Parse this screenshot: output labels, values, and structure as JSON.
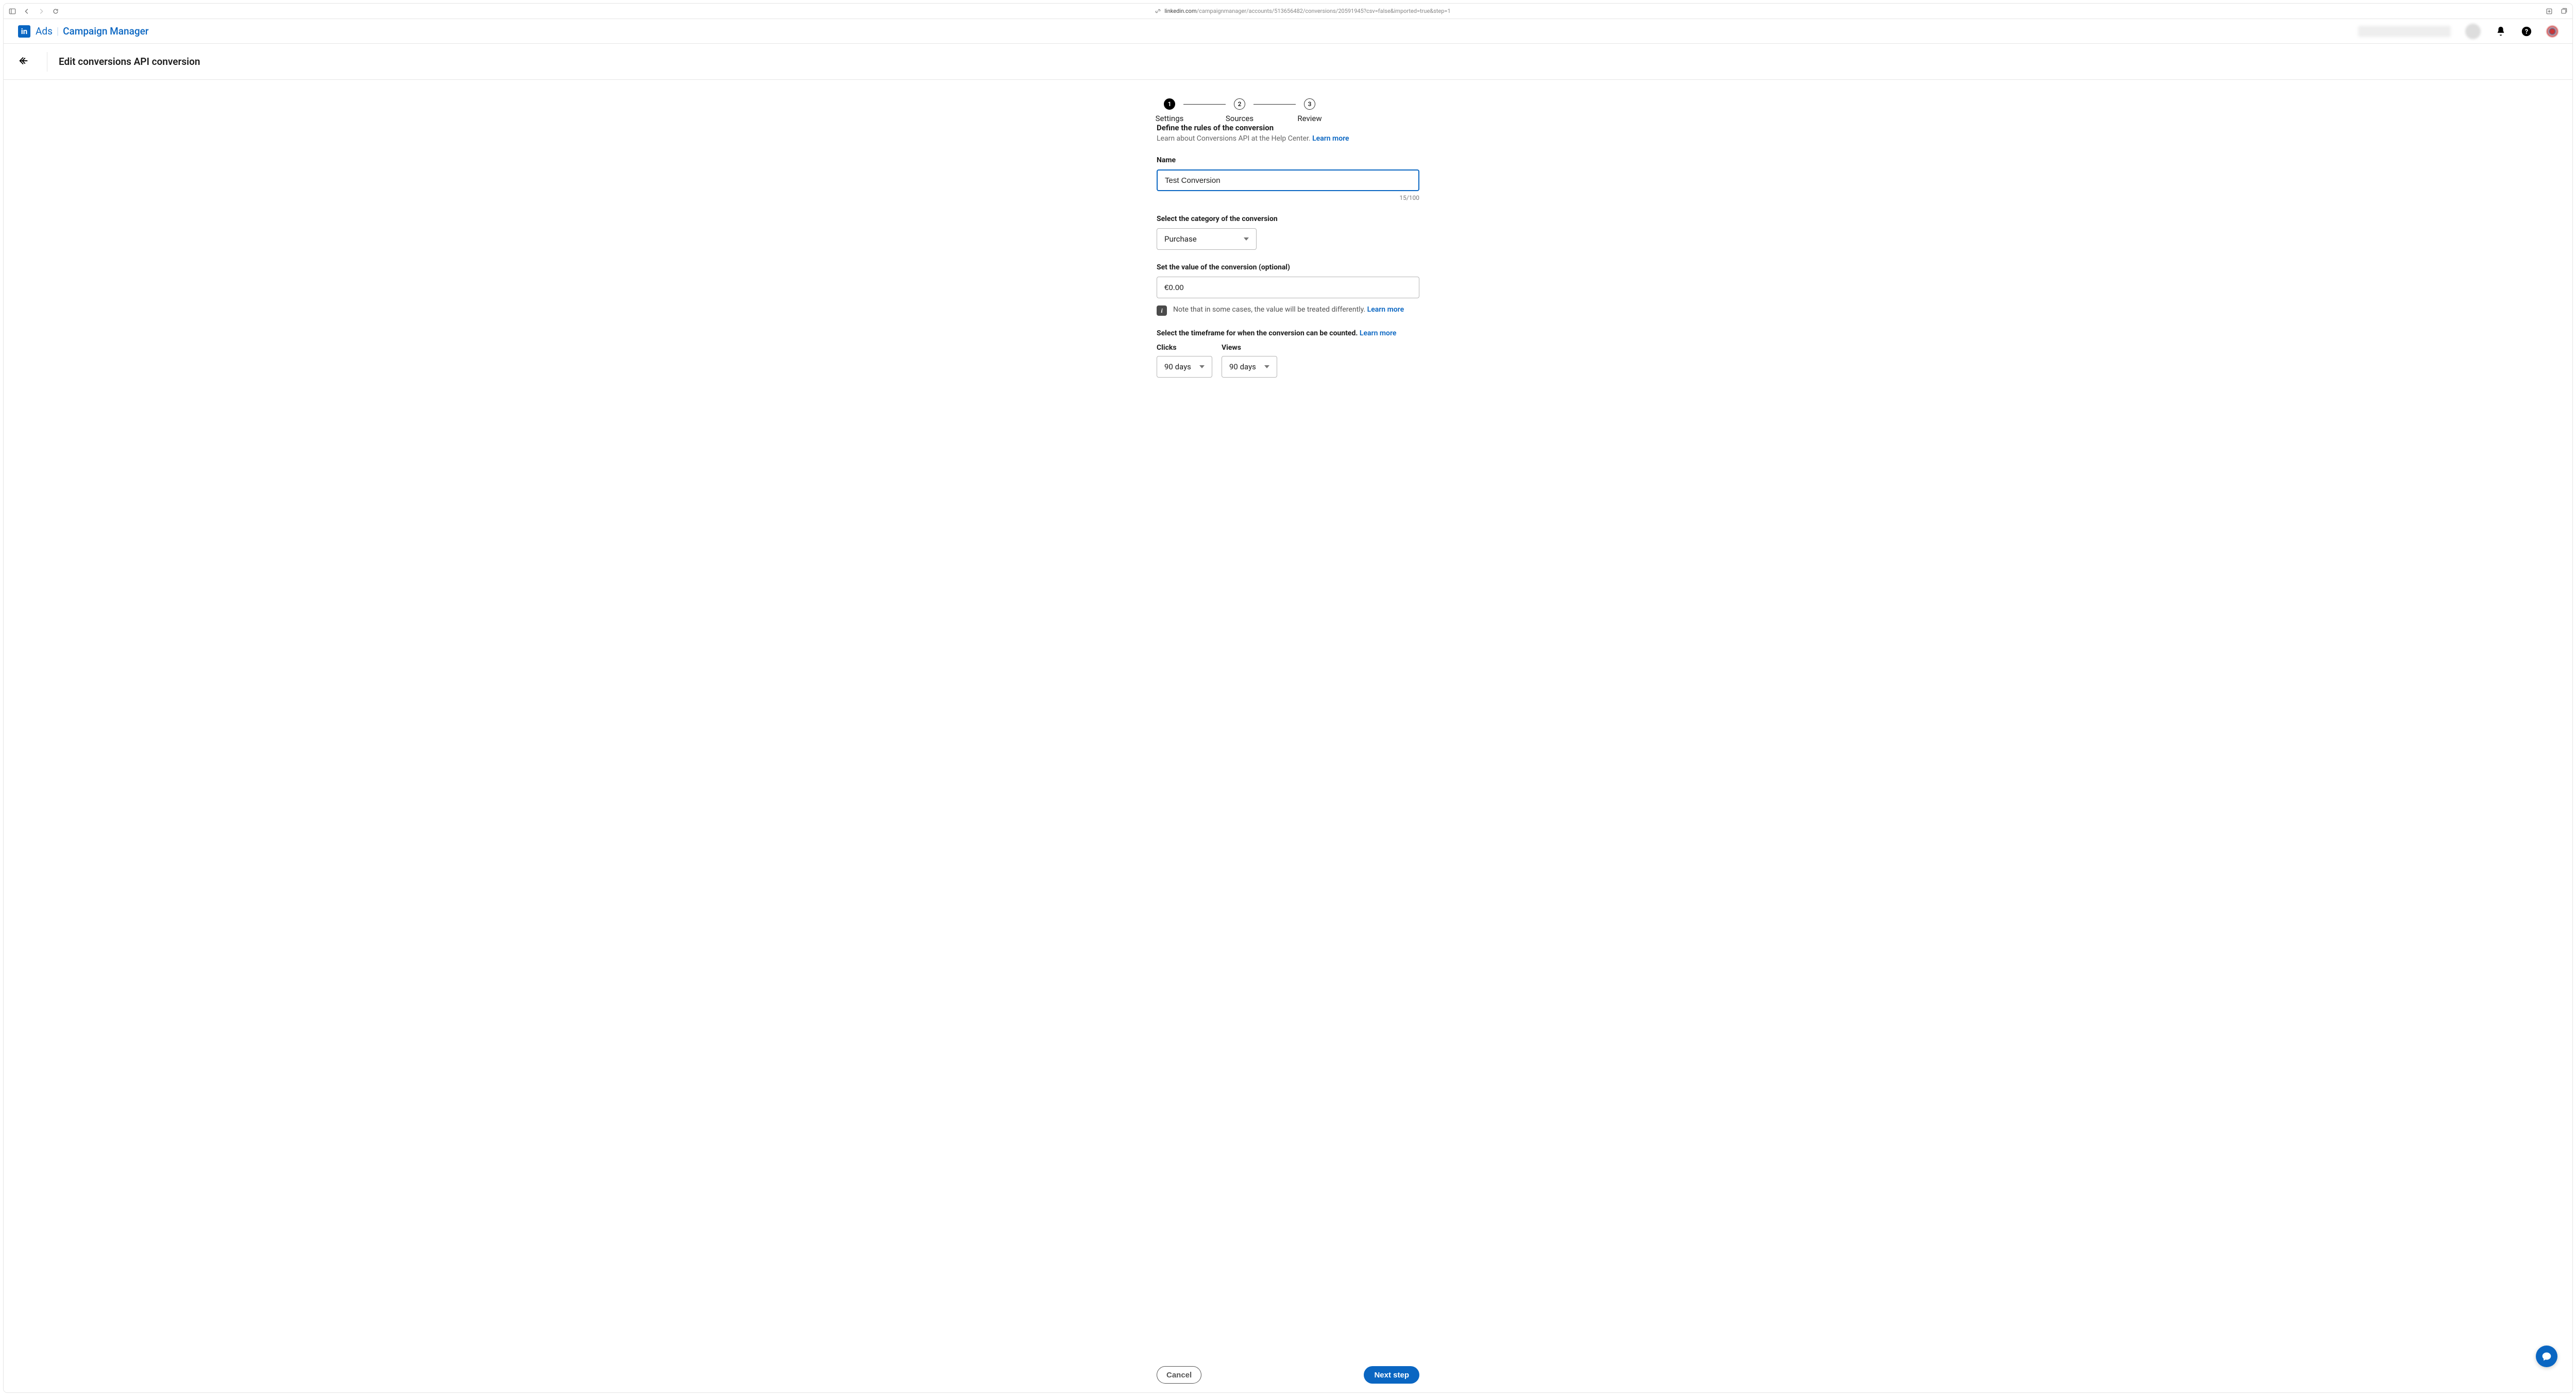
{
  "browser": {
    "url_domain": "linkedin.com",
    "url_path": "/campaignmanager/accounts/513656482/conversions/20591945?csv=false&imported=true&step=1"
  },
  "header": {
    "brand_ads": "Ads",
    "brand_cm": "Campaign Manager"
  },
  "page": {
    "title": "Edit conversions API conversion"
  },
  "stepper": {
    "s1": {
      "num": "1",
      "label": "Settings"
    },
    "s2": {
      "num": "2",
      "label": "Sources"
    },
    "s3": {
      "num": "3",
      "label": "Review"
    }
  },
  "define": {
    "title": "Define the rules of the conversion",
    "sub": "Learn about Conversions API at the Help Center.",
    "learn": "Learn more"
  },
  "name": {
    "label": "Name",
    "value": "Test Conversion",
    "count": "15/100"
  },
  "category": {
    "label": "Select the category of the conversion",
    "value": "Purchase"
  },
  "value": {
    "label": "Set the value of the conversion (optional)",
    "value": "€0.00"
  },
  "note": {
    "text": "Note that in some cases, the value will be treated differently.",
    "learn": "Learn more"
  },
  "timeframe": {
    "label": "Select the timeframe for when the conversion can be counted.",
    "learn": "Learn more",
    "clicks_label": "Clicks",
    "clicks_value": "90 days",
    "views_label": "Views",
    "views_value": "90 days"
  },
  "footer": {
    "cancel": "Cancel",
    "next": "Next step"
  }
}
